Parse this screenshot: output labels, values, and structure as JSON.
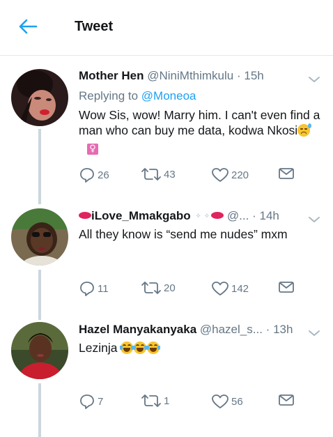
{
  "header": {
    "title": "Tweet"
  },
  "tweets": [
    {
      "name": "Mother Hen",
      "handle": "@NiniMthimkulu",
      "dot": "·",
      "time": "15h",
      "replying_prefix": "Replying to ",
      "replying_to": "@Moneoa",
      "text": "Wow Sis, wow! Marry him. I can't even find a man who can buy me data, kodwa Nkosi",
      "replies": "26",
      "retweets": "43",
      "likes": "220"
    },
    {
      "name": "iLove_Mmakgabo",
      "handle": "@...",
      "dot": "·",
      "time": "14h",
      "text": "All they know is “send me nudes” mxm",
      "replies": "11",
      "retweets": "20",
      "likes": "142"
    },
    {
      "name": "Hazel Manyakanyaka",
      "handle": "@hazel_s...",
      "dot": "·",
      "time": "13h",
      "text": "Lezinja",
      "replies": "7",
      "retweets": "1",
      "likes": "56"
    }
  ],
  "icons": {
    "back": "arrow-left-icon",
    "caret": "chevron-down-icon",
    "reply": "reply-icon",
    "retweet": "retweet-icon",
    "like": "heart-icon",
    "dm": "envelope-icon"
  },
  "colors": {
    "accent": "#1da1f2",
    "secondary_text": "#657786",
    "thread_line": "#ccd6dd"
  }
}
